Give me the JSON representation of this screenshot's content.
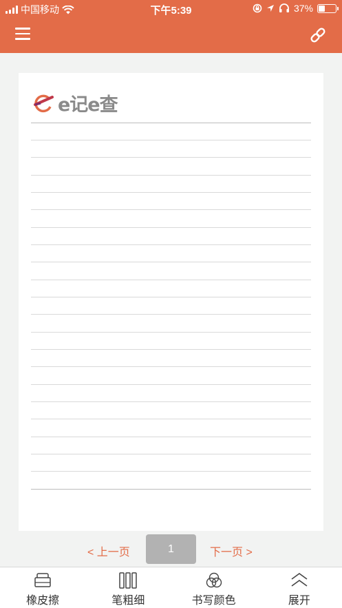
{
  "status_bar": {
    "carrier": "中国移动",
    "time": "下午5:39",
    "battery_percent_label": "37%",
    "battery_level": 0.37
  },
  "nav": {
    "menu_icon": "hamburger-menu-icon",
    "link_icon": "link-icon"
  },
  "note": {
    "logo_text": "e记e查",
    "line_count": 21
  },
  "pager": {
    "prev_label": "< 上一页",
    "page_number": "1",
    "next_label": "下一页 >"
  },
  "toolbar": {
    "items": [
      {
        "label": "橡皮擦",
        "icon": "eraser-icon"
      },
      {
        "label": "笔粗细",
        "icon": "pen-width-icon"
      },
      {
        "label": "书写颜色",
        "icon": "color-circles-icon"
      },
      {
        "label": "展开",
        "icon": "chevron-up-icon"
      }
    ]
  },
  "colors": {
    "accent": "#e36c48",
    "page_badge": "#b2b2b2",
    "background": "#f2f3f2"
  }
}
